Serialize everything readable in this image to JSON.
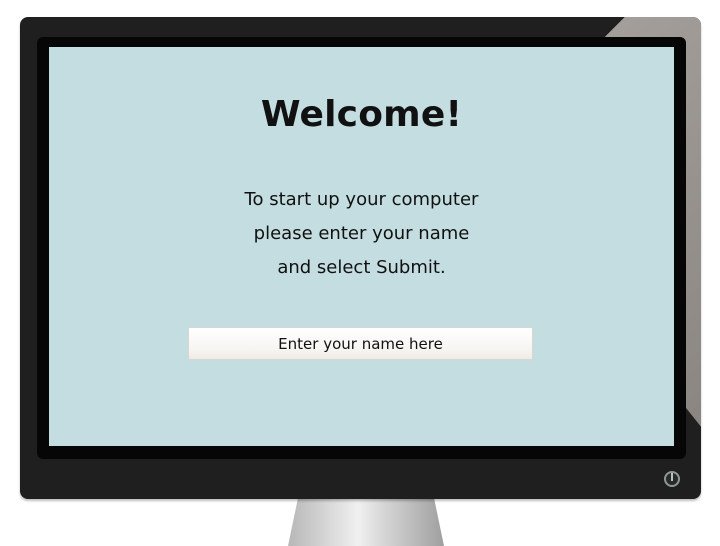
{
  "screen": {
    "title": "Welcome!",
    "message_lines": [
      "To start up your computer",
      "please enter your name",
      "and select Submit."
    ],
    "input": {
      "placeholder": "Enter your name here",
      "value": ""
    }
  },
  "icons": {
    "power": "power-icon"
  },
  "colors": {
    "screen_background": "#c4dde0",
    "frame": "#1f1f1f",
    "bezel": "#060606"
  }
}
